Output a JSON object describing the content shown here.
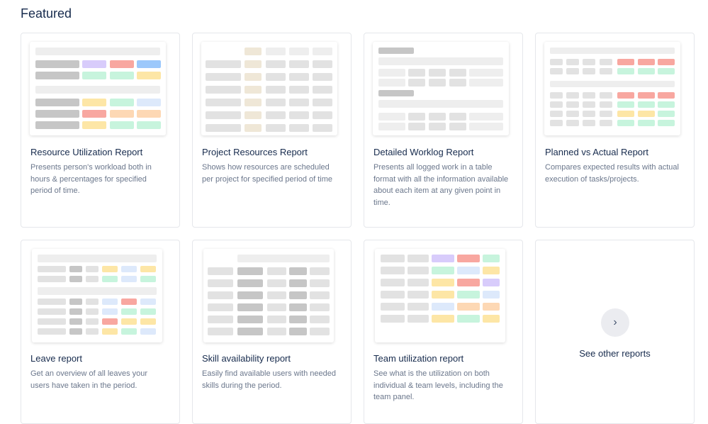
{
  "section": {
    "title": "Featured"
  },
  "colors": {
    "grey_light": "#eeeeee",
    "grey_mid": "#e2e2e2",
    "grey_dark": "#c6c6c6",
    "purple": "#d8ccfb",
    "red": "#f8a7a0",
    "blue": "#9cc8fb",
    "blue_light": "#dde9fb",
    "green": "#c7f4dd",
    "yellow": "#fde6a6",
    "orange": "#fdd8b4",
    "beige": "#efe7d7"
  },
  "cards": [
    {
      "title": "Resource Utilization Report",
      "description": "Presents person's workload both in hours & percentages for specified period of time."
    },
    {
      "title": "Project Resources Report",
      "description": "Shows how resources are scheduled per project for specified period of time"
    },
    {
      "title": "Detailed Worklog Report",
      "description": "Presents all logged work in a table format with all the information available about each item at any given point in time."
    },
    {
      "title": "Planned vs Actual Report",
      "description": "Compares expected results with actual execution of tasks/projects."
    },
    {
      "title": "Leave report",
      "description": "Get an overview of all leaves your users have taken in the period."
    },
    {
      "title": "Skill availability report",
      "description": "Easily find available users with needed skills during the period."
    },
    {
      "title": "Team utilization report",
      "description": "See what is the utilization on both individual & team levels, including the team panel."
    }
  ],
  "other": {
    "label": "See other reports",
    "icon": "chevron-right-icon",
    "glyph": "›"
  }
}
